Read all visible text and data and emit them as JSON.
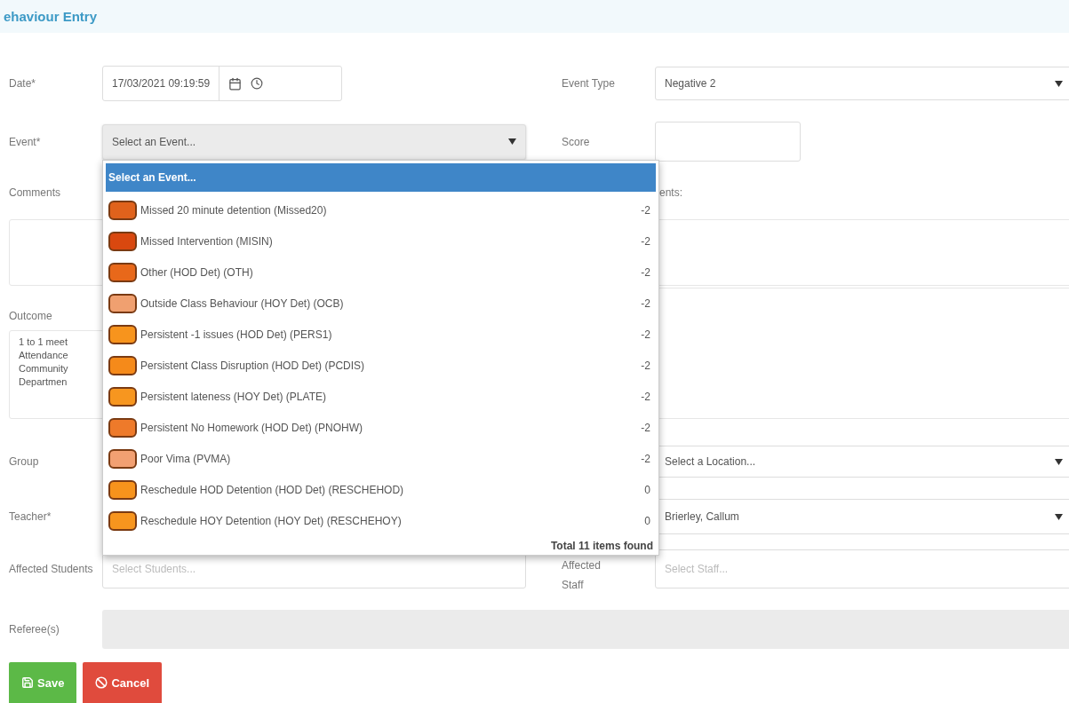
{
  "header": {
    "title": "ehaviour Entry"
  },
  "form": {
    "date": {
      "label": "Date*",
      "value": "17/03/2021 09:19:59"
    },
    "event_type": {
      "label": "Event Type",
      "value": "Negative 2"
    },
    "event": {
      "label": "Event*",
      "placeholder": "Select an Event...",
      "open": true
    },
    "score": {
      "label": "Score"
    },
    "comments": {
      "label": "Comments"
    },
    "comments_right": {
      "label": "ents:"
    },
    "outcome": {
      "label": "Outcome",
      "items": [
        "1 to 1 meet",
        "Attendance",
        "Community",
        "Departmen"
      ]
    },
    "group": {
      "label": "Group",
      "location_placeholder": "Select a Location..."
    },
    "teacher": {
      "label": "Teacher*",
      "value": "Brierley, Callum"
    },
    "affected_students": {
      "label": "Affected Students",
      "placeholder": "Select Students..."
    },
    "affected_staff": {
      "label": "Affected Staff",
      "placeholder": "Select Staff..."
    },
    "referees": {
      "label": "Referee(s)",
      "disabled": true
    }
  },
  "event_dropdown": {
    "options": [
      {
        "label": "Select an Event...",
        "selected": true
      },
      {
        "label": "Missed 20 minute detention (Missed20)",
        "score": "-2",
        "color": "#e0621c",
        "selected": false
      },
      {
        "label": "Missed Intervention (MISIN)",
        "score": "-2",
        "color": "#d9480f",
        "selected": false
      },
      {
        "label": "Other (HOD Det) (OTH)",
        "score": "-2",
        "color": "#e8681a",
        "selected": false
      },
      {
        "label": "Outside Class Behaviour (HOY Det) (OCB)",
        "score": "-2",
        "color": "#f0a070",
        "selected": false
      },
      {
        "label": "Persistent -1 issues (HOD Det) (PERS1)",
        "score": "-2",
        "color": "#f7941d",
        "selected": false
      },
      {
        "label": "Persistent Class Disruption (HOD Det) (PCDIS)",
        "score": "-2",
        "color": "#f58a1a",
        "selected": false
      },
      {
        "label": "Persistent lateness (HOY Det) (PLATE)",
        "score": "-2",
        "color": "#f7961f",
        "selected": false
      },
      {
        "label": "Persistent No Homework (HOD Det) (PNOHW)",
        "score": "-2",
        "color": "#ee7a2a",
        "selected": false
      },
      {
        "label": "Poor Vima (PVMA)",
        "score": "-2",
        "color": "#f2a072",
        "selected": false
      },
      {
        "label": "Reschedule HOD Detention (HOD Det) (RESCHEHOD)",
        "score": "0",
        "color": "#f7931c",
        "selected": false
      },
      {
        "label": "Reschedule HOY Detention (HOY Det) (RESCHEHOY)",
        "score": "0",
        "color": "#f7951e",
        "selected": false
      }
    ],
    "footer": "Total 11 items found"
  },
  "buttons": [
    {
      "kind": "save",
      "label": "Save"
    },
    {
      "kind": "cancel",
      "label": "Cancel"
    }
  ]
}
